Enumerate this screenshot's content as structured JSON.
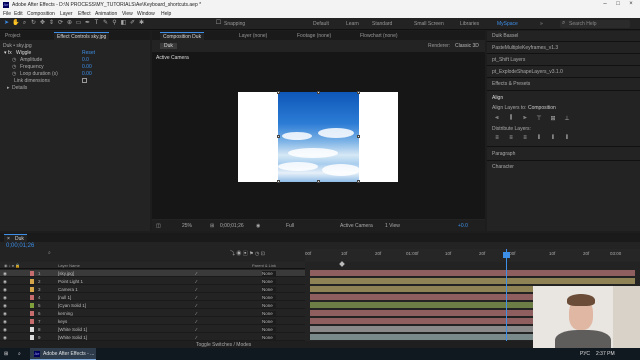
{
  "window": {
    "title": "Adobe After Effects - D:\\N PROCESS\\MY_TUTORIALS\\Ae\\Keyboard_shortcuts.aep *",
    "app_icon": "Ae"
  },
  "menu": [
    "File",
    "Edit",
    "Composition",
    "Layer",
    "Effect",
    "Animation",
    "View",
    "Window",
    "Help"
  ],
  "toolbar": {
    "snapping_label": "Snapping",
    "workspaces": [
      {
        "label": "Default",
        "active": false
      },
      {
        "label": "Learn",
        "active": false
      },
      {
        "label": "Standard",
        "active": false
      },
      {
        "label": "Small Screen",
        "active": false
      },
      {
        "label": "Libraries",
        "active": false
      },
      {
        "label": "MySpace",
        "active": true
      }
    ],
    "search_placeholder": "Search Help"
  },
  "effect_controls": {
    "tab_project": "Project",
    "tab_label": "Effect Controls sky.jpg",
    "breadcrumb": "Duk • sky.jpg",
    "effect_name": "Wiggle",
    "effect_value": "Reset",
    "properties": [
      {
        "label": "Amplitude",
        "value": "0.0"
      },
      {
        "label": "Frequency",
        "value": "0.00"
      },
      {
        "label": "Loop duration (s)",
        "value": "0.00"
      }
    ],
    "checkbox_label": "Link dimensions",
    "details_label": "Details"
  },
  "composition": {
    "tab_label": "Composition Duk",
    "layer_tab": "Layer (none)",
    "footage_tab": "Footage (none)",
    "flowchart_tab": "Flowchart (none)",
    "comp_chip": "Duk",
    "renderer": "Renderer:",
    "renderer_value": "Classic 3D",
    "active_camera": "Active Camera",
    "bottom_bar": {
      "zoom": "25%",
      "timecode": "0;00;01;26",
      "resolution": "Full",
      "camera": "Active Camera",
      "view": "1 View",
      "exposure": "+0.0"
    }
  },
  "right_panel": {
    "header": "Duik Bassel",
    "scripts": [
      "PasteMultipleKeyframes_v1.3",
      "pt_Shift Layers",
      "pt_ExplodeShapeLayers_v3.1.0",
      "Effects & Presets"
    ],
    "align_title": "Align",
    "align_layers_to": "Align Layers to:",
    "align_target": "Composition",
    "distribute_label": "Distribute Layers:",
    "paragraph": "Paragraph",
    "character": "Character"
  },
  "timeline": {
    "tab_label": "Duk",
    "timecode": "0;00;01;26",
    "columns": {
      "source": "Layer Name",
      "parent": "Parent & Link"
    },
    "ruler_labels": [
      "00f",
      "10f",
      "20f",
      "01:00f",
      "10f",
      "20f",
      "02:00f",
      "10f",
      "20f",
      "03:00"
    ],
    "layers": [
      {
        "num": "1",
        "name": "[sky.jpg]",
        "parent": "None",
        "color": "#c86d6d",
        "selected": true
      },
      {
        "num": "2",
        "name": "Point Light 1",
        "parent": "None",
        "color": "#d4a649"
      },
      {
        "num": "3",
        "name": "Camera 1",
        "parent": "None",
        "color": "#d4a649"
      },
      {
        "num": "4",
        "name": "[null 1]",
        "parent": "None",
        "color": "#c86d6d"
      },
      {
        "num": "5",
        "name": "[Cyan Solid 1]",
        "parent": "None",
        "color": "#7f9f3c"
      },
      {
        "num": "6",
        "name": "kerning",
        "parent": "None",
        "color": "#c86d6d"
      },
      {
        "num": "7",
        "name": "keys",
        "parent": "None",
        "color": "#c86d6d"
      },
      {
        "num": "8",
        "name": "[White Solid 1]",
        "parent": "None",
        "color": "#dcdcdc"
      },
      {
        "num": "9",
        "name": "[White Solid 1]",
        "parent": "None",
        "color": "#dcdcdc"
      },
      {
        "num": "10",
        "name": "[White Solid 1]",
        "parent": "None",
        "color": "#dcdcdc"
      }
    ],
    "footer_label": "Toggle Switches / Modes"
  },
  "taskbar": {
    "app_label": "Adobe After Effects - ...",
    "language": "РУС",
    "time": "2:37 PM"
  }
}
